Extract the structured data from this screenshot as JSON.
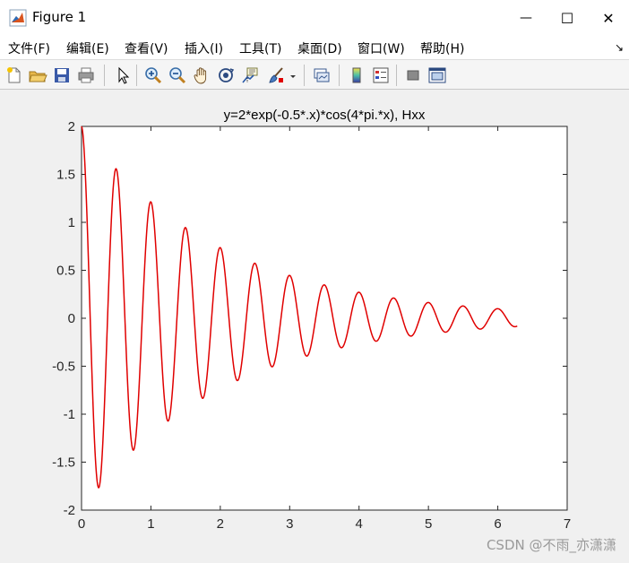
{
  "window": {
    "title": "Figure 1",
    "minimize_glyph": "—",
    "maximize_glyph": "☐",
    "close_glyph": "✕"
  },
  "menu": {
    "items": [
      "文件(F)",
      "编辑(E)",
      "查看(V)",
      "插入(I)",
      "工具(T)",
      "桌面(D)",
      "窗口(W)",
      "帮助(H)"
    ],
    "overflow_glyph": "↘"
  },
  "toolbar": {
    "icons": [
      "new-figure-icon",
      "open-file-icon",
      "save-icon",
      "print-icon",
      "select-pointer-icon",
      "zoom-in-icon",
      "zoom-out-icon",
      "pan-hand-icon",
      "rotate-3d-icon",
      "data-cursor-icon",
      "brush-icon",
      "link-plot-icon",
      "insert-colorbar-icon",
      "insert-legend-icon",
      "hide-plot-tools-icon",
      "show-plot-tools-icon"
    ]
  },
  "watermark": "CSDN @不雨_亦潇潇",
  "chart_data": {
    "type": "line",
    "title": "y=2*exp(-0.5*.x)*cos(4*pi.*x), Hxx",
    "xlabel": "",
    "ylabel": "",
    "xlim": [
      0,
      7
    ],
    "ylim": [
      -2,
      2
    ],
    "xticks": [
      "0",
      "1",
      "2",
      "3",
      "4",
      "5",
      "6",
      "7"
    ],
    "yticks": [
      "2",
      "1.5",
      "1",
      "0.5",
      "0",
      "-0.5",
      "-1",
      "-1.5",
      "-2"
    ],
    "x_range": [
      0,
      6.28
    ],
    "series": [
      {
        "color": "#e00000",
        "x": [
          0,
          0.25,
          0.5,
          0.75,
          1.0,
          1.25,
          1.5,
          1.75,
          2.0,
          2.25,
          2.5,
          2.75,
          3.0,
          3.25,
          3.5,
          3.75,
          4.0,
          4.25,
          4.5,
          4.75,
          5.0,
          5.25,
          5.5,
          5.75,
          6.0,
          6.25,
          6.28
        ],
        "y": [
          2.0,
          -1.76,
          1.56,
          -1.37,
          1.21,
          -1.07,
          0.94,
          -0.83,
          0.74,
          -0.65,
          0.57,
          -0.5,
          0.45,
          -0.39,
          0.35,
          -0.31,
          0.27,
          -0.24,
          0.21,
          -0.19,
          0.16,
          -0.15,
          0.13,
          -0.11,
          0.1,
          -0.09,
          -0.08
        ]
      }
    ],
    "grid": false,
    "legend": "none"
  }
}
